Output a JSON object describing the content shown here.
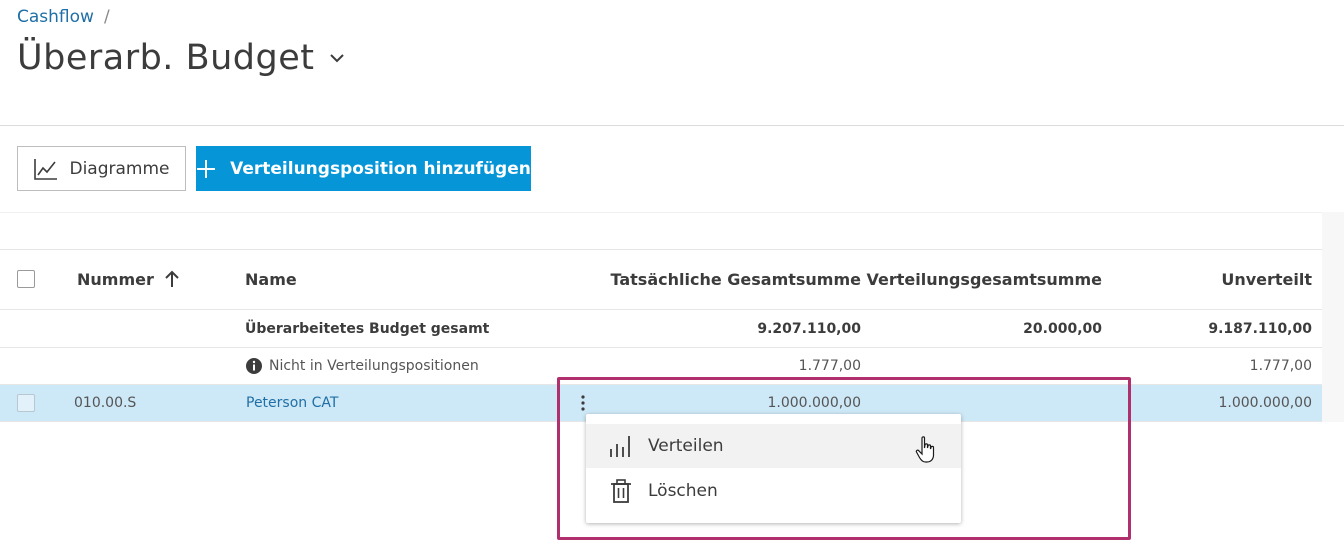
{
  "breadcrumb": {
    "parent": "Cashflow",
    "separator": "/"
  },
  "header": {
    "title": "Überarb. Budget",
    "chevron_icon": "chevron-down-icon"
  },
  "toolbar": {
    "charts_label": "Diagramme",
    "charts_icon": "line-chart-icon",
    "add_label": "Verteilungsposition hinzufügen",
    "add_icon": "plus-icon"
  },
  "table": {
    "columns": {
      "number": "Nummer",
      "name": "Name",
      "actual_total": "Tatsächliche Gesamtsumme",
      "distribution_total": "Verteilungsgesamtsumme",
      "undistributed": "Unverteilt"
    },
    "sort_icon": "arrow-up-icon",
    "rows": [
      {
        "number": "",
        "name": "Überarbeitetes Budget gesamt",
        "actual_total": "9.207.110,00",
        "distribution_total": "20.000,00",
        "undistributed": "9.187.110,00"
      },
      {
        "number": "",
        "name": "Nicht in Verteilungspositionen",
        "actual_total": "1.777,00",
        "distribution_total": "",
        "undistributed": "1.777,00"
      },
      {
        "number": "010.00.S",
        "name": "Peterson CAT",
        "actual_total": "1.000.000,00",
        "distribution_total": "",
        "undistributed": "1.000.000,00"
      }
    ]
  },
  "context_menu": {
    "items": [
      {
        "label": "Verteilen",
        "icon": "distribute-bars-icon"
      },
      {
        "label": "Löschen",
        "icon": "trash-icon"
      }
    ]
  },
  "colors": {
    "primary": "#0696d7",
    "link": "#1f6fa6",
    "selected_row": "#cde8f6",
    "highlight": "#b0306e"
  }
}
